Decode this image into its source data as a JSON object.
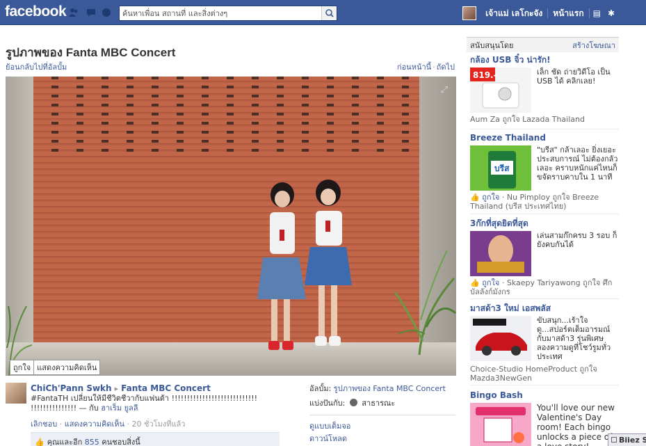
{
  "header": {
    "logo": "facebook",
    "search_placeholder": "ค้นหาเพื่อน สถานที่ และสิ่งต่างๆ",
    "user_name": "เจ้าแม่ เลโกะจัง",
    "home_label": "หน้าแรก"
  },
  "photo": {
    "title": "รูปภาพของ Fanta MBC Concert",
    "back_link": "ย้อนกลับไปที่อัลบั้ม",
    "prev_label": "ก่อนหน้านี้",
    "next_label": "ถัดไป",
    "like_action": "ถูกใจ",
    "comment_action": "แสดงความคิดเห็น"
  },
  "caption": {
    "author": "ChiCh'Pann Swkh",
    "page": "Fanta MBC Concert",
    "text_line1": "#FantaTH เปลี่ยนให้มีชีวิตชีวากับแฟนต้า !!!!!!!!!!!!!!!!!!!!!!!!!!!!",
    "text_line2": "!!!!!!!!!!!!!!! — กับ",
    "tagged": "ฮาเร็ม ยูลลี",
    "unlike": "เลิกชอบ",
    "comment": "แสดงความคิดเห็น",
    "time": "20 ชั่วโมงที่แล้ว",
    "likes_prefix": "คุณและอีก",
    "likes_count": "855",
    "likes_suffix": "คนชอบสิ่งนี้"
  },
  "side_meta": {
    "album_label": "อัลบั้ม:",
    "album_value": "รูปภาพของ Fanta MBC Concert",
    "shared_label": "แบ่งปันกับ:",
    "shared_value": "สาธารณะ",
    "fullscreen": "ดูแบบเต็มจอ",
    "download": "ดาวน์โหลด"
  },
  "ads_header": {
    "title": "สนับสนุนโดย",
    "create": "สร้างโฆษณา"
  },
  "ads": [
    {
      "title": "กล้อง USB จิ๋ว น่ารัก!",
      "text": "เล็ก ชัด ถ่ายวิดีโอ เป็น USB ได้ คลิกเลย!",
      "social_name": "Aum Za",
      "social_verb": "ถูกใจ",
      "social_target": "Lazada Thailand",
      "price": "819.-"
    },
    {
      "title": "Breeze Thailand",
      "text": "\"บรีส\" กล้าเลอะ ยิ่งเยอะประสบการณ์ ไม่ต้องกลัวเลอะ คราบหนักแค่ไหนก็ขจัดราบคาบใน 1 นาที",
      "social_like": "ถูกใจ",
      "social_name": "Nu Pimploy",
      "social_verb": "ถูกใจ",
      "social_target": "Breeze Thailand (บรีส ประเทศไทย)"
    },
    {
      "title": "3ก๊กที่สุดยิดที่สุด",
      "text": "เล่นสามก๊กครบ 3 รอบ ก็ยังคบกันได้",
      "social_like": "ถูกใจ",
      "social_name": "Skaepy Tariyawong",
      "social_verb": "ถูกใจ",
      "social_target": "ศึกบัลลังก์มังกร"
    },
    {
      "title": "มาสด้า3 ใหม่ เอสพลัส",
      "text": "ขับสนุก...เร้าใจ ดู...สปอร์ตเต็มอารมณ์ กับมาสด้า3 รุ่นพิเศษ ลองความดูที่โชว์รูมทั่วประเทศ",
      "social_name": "Choice-Studio HomeProduct",
      "social_verb": "ถูกใจ",
      "social_target": "Mazda3NewGen"
    },
    {
      "title": "Bingo Bash",
      "text": "You'll love our new Valentine's Day room! Each bingo unlocks a piece of a love story!"
    }
  ],
  "chat": {
    "label": "Biiez S"
  },
  "colors": {
    "brand": "#3b5998",
    "link": "#3b5998"
  }
}
